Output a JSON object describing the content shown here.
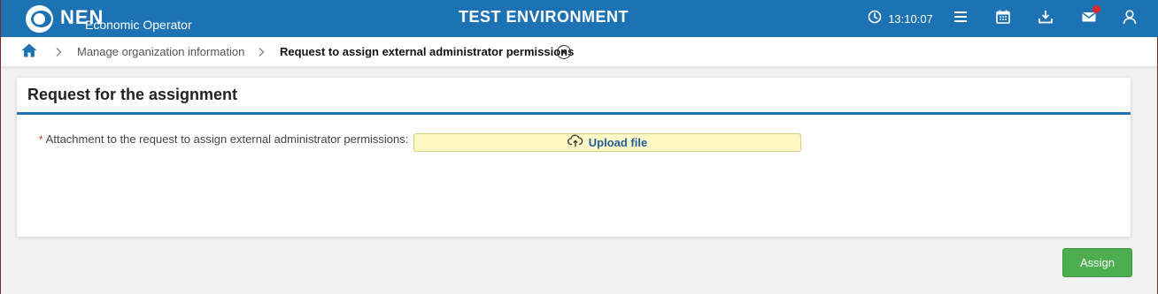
{
  "header": {
    "logo_text": "NEN",
    "logo_subtitle": "Economic Operator",
    "environment": "TEST ENVIRONMENT",
    "time": "13:10:07",
    "icons": [
      "clock-icon",
      "menu-icon",
      "calendar-icon",
      "download-icon",
      "mail-icon",
      "user-icon"
    ],
    "mail_has_notification": true,
    "colors": {
      "bar": "#1d72b3",
      "notification": "#d9262c"
    }
  },
  "breadcrumb": {
    "home_icon": "home-icon",
    "items": [
      {
        "label": "Manage organization information"
      },
      {
        "label": "Request to assign external administrator permissions"
      }
    ]
  },
  "panel": {
    "title": "Request for the assignment",
    "field": {
      "required_marker": "*",
      "label": "Attachment to the request to assign external administrator permissions:",
      "upload_label": "Upload file",
      "upload_icon": "cloud-upload-icon"
    }
  },
  "actions": {
    "assign_label": "Assign",
    "assign_color": "#4cae4f"
  }
}
